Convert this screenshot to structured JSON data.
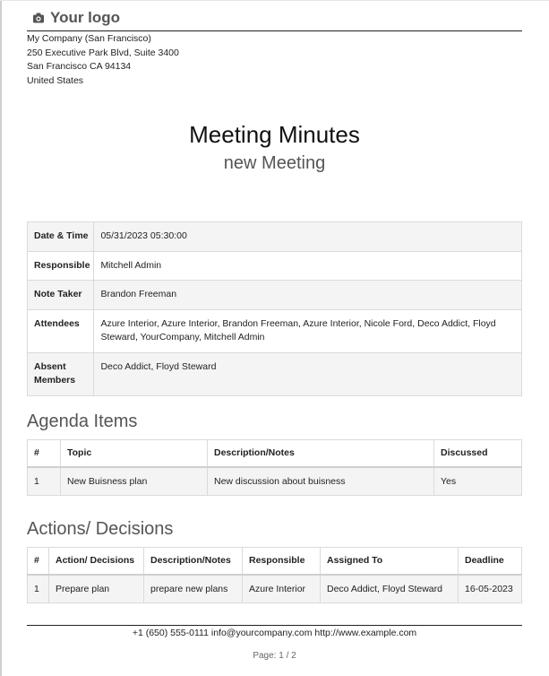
{
  "header": {
    "logo_text": "Your logo",
    "logo_icon": "camera-icon",
    "address": [
      "My Company (San Francisco)",
      "250 Executive Park Blvd, Suite 3400",
      "San Francisco CA 94134",
      "United States"
    ]
  },
  "document": {
    "title": "Meeting Minutes",
    "subtitle": "new Meeting"
  },
  "info": {
    "date_label": "Date & Time",
    "date_value": "05/31/2023 05:30:00",
    "responsible_label": "Responsible",
    "responsible_value": "Mitchell Admin",
    "note_taker_label": "Note Taker",
    "note_taker_value": "Brandon Freeman",
    "attendees_label": "Attendees",
    "attendees_value": "Azure Interior, Azure Interior, Brandon Freeman, Azure Interior, Nicole Ford, Deco Addict, Floyd Steward, YourCompany, Mitchell Admin",
    "absent_label": "Absent Members",
    "absent_value": "Deco Addict, Floyd Steward"
  },
  "agenda": {
    "title": "Agenda Items",
    "headers": [
      "#",
      "Topic",
      "Description/Notes",
      "Discussed"
    ],
    "rows": [
      [
        "1",
        "New Buisness plan",
        "New discussion about buisness",
        "Yes"
      ]
    ]
  },
  "actions": {
    "title": "Actions/ Decisions",
    "headers": [
      "#",
      "Action/ Decisions",
      "Description/Notes",
      "Responsible",
      "Assigned To",
      "Deadline"
    ],
    "rows": [
      [
        "1",
        "Prepare plan",
        "prepare new plans",
        "Azure Interior",
        "Deco Addict, Floyd Steward",
        "16-05-2023"
      ]
    ]
  },
  "footer": {
    "contact": "+1 (650) 555-0111 info@yourcompany.com http://www.example.com",
    "page": "Page: 1 / 2"
  }
}
